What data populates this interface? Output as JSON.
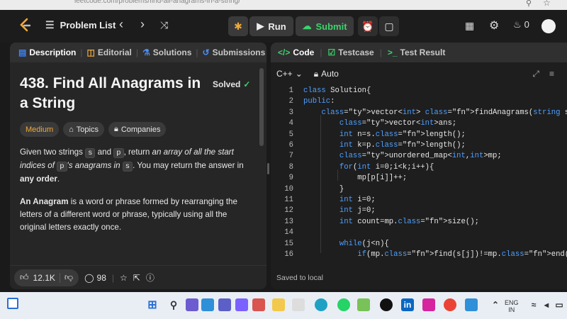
{
  "browser": {
    "url": "leetcode.com/problems/find-all-anagrams-in-a-string/"
  },
  "topbar": {
    "problem_list": "Problem List",
    "run": "Run",
    "submit": "Submit",
    "streak": "0"
  },
  "left": {
    "tabs": [
      "Description",
      "Editorial",
      "Solutions",
      "Submissions"
    ],
    "title": "438. Find All Anagrams in a String",
    "solved": "Solved",
    "chips": [
      "Medium",
      "Topics",
      "Companies"
    ],
    "desc": {
      "p1_a": "Given two strings ",
      "s": "s",
      "p1_b": " and ",
      "p": "p",
      "p1_c": ", return ",
      "p1_em": "an array of all the start indices of ",
      "p1_em2": "'s anagrams in ",
      "p1_d": ". You may return the answer in ",
      "p1_bold": "any order",
      "p1_e": ".",
      "p2_bold": "An Anagram",
      "p2_rest": " is a word or phrase formed by rearranging the letters of a different word or phrase, typically using all the original letters exactly once."
    },
    "likes": "12.1K",
    "comments": "98"
  },
  "right": {
    "tabs": [
      "Code",
      "Testcase",
      "Test Result"
    ],
    "language": "C++",
    "mode": "Auto",
    "saved": "Saved to local",
    "code_lines": [
      {
        "n": "1",
        "t": "class Solution{"
      },
      {
        "n": "2",
        "t": "public:"
      },
      {
        "n": "3",
        "t": "    vector<int> findAnagrams(string s, string p) {"
      },
      {
        "n": "4",
        "t": "        vector<int>ans;"
      },
      {
        "n": "5",
        "t": "        int n=s.length();"
      },
      {
        "n": "6",
        "t": "        int k=p.length();"
      },
      {
        "n": "7",
        "t": "        unordered_map<int,int>mp;"
      },
      {
        "n": "8",
        "t": "        for(int i=0;i<k;i++){"
      },
      {
        "n": "9",
        "t": "            mp[p[i]]++;"
      },
      {
        "n": "10",
        "t": "        }"
      },
      {
        "n": "11",
        "t": "        int i=0;"
      },
      {
        "n": "12",
        "t": "        int j=0;"
      },
      {
        "n": "13",
        "t": "        int count=mp.size();"
      },
      {
        "n": "14",
        "t": ""
      },
      {
        "n": "15",
        "t": "        while(j<n){"
      },
      {
        "n": "16",
        "t": "            if(mp.find(s[j])!=mp.end()){"
      }
    ]
  },
  "taskbar": {
    "lang": "ENG",
    "region": "IN"
  },
  "colors": {
    "accent_green": "#3bd36b",
    "medium": "#f0a93b",
    "keyword": "#4ea0ff"
  }
}
